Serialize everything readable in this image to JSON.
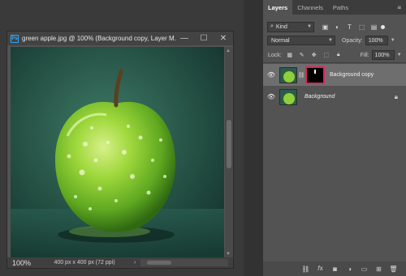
{
  "document": {
    "title": "green apple.jpg @ 100% (Background copy, Layer M...",
    "ps_badge": "Ps",
    "minimize": "—",
    "maximize": "☐",
    "close": "✕",
    "zoom": "100%",
    "doc_info": "400 px x 400 px (72 ppi)",
    "status_arrow": "›"
  },
  "layers_panel": {
    "tabs": [
      "Layers",
      "Channels",
      "Paths"
    ],
    "active_tab": "Layers",
    "menu_icon": "≡",
    "filter_kind": "Kind",
    "blend_mode": "Normal",
    "opacity_label": "Opacity:",
    "opacity_value": "100%",
    "lock_label": "Lock:",
    "fill_label": "Fill:",
    "fill_value": "100%",
    "layers": [
      {
        "name": "Background copy",
        "selected": true,
        "has_mask": true
      },
      {
        "name": "Background",
        "selected": false,
        "locked": true
      }
    ]
  },
  "colors": {
    "panel_bg": "#535353",
    "selected_layer": "#6e6e6e",
    "mask_border": "#e0245e",
    "accent_ps": "#31a8ff"
  }
}
